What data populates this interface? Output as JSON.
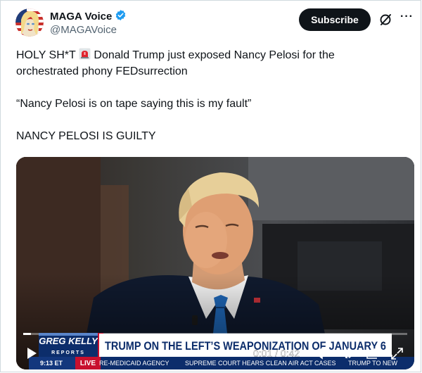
{
  "author": {
    "name": "MAGA Voice",
    "handle": "@MAGAVoice",
    "verified": true
  },
  "actions": {
    "subscribe_label": "Subscribe",
    "more_label": "···"
  },
  "tweet": {
    "line1_pre": "HOLY SH*T",
    "line1_post": "Donald Trump just exposed Nancy Pelosi for the",
    "line2": "orchestrated phony FEDsurrection",
    "quote": "“Nancy Pelosi is on tape saying this is my fault”",
    "closing": "NANCY PELOSI IS GUILTY"
  },
  "video": {
    "chyron_brand_top": "GREG KELLY",
    "chyron_brand_bottom": "REPORTS",
    "chyron_headline": "TRUMP ON THE LEFT’S WEAPONIZATION OF JANUARY 6",
    "ticker_time": "9:13 ET",
    "ticker_live": "LIVE",
    "ticker_item1": "RE-MEDICAID AGENCY",
    "ticker_item2": "SUPREME COURT HEARS CLEAN AIR ACT CASES",
    "ticker_item3": "TRUMP TO NEW",
    "time_display": "0:01 / 0:42",
    "progress_fraction": 0.02
  },
  "colors": {
    "accent_verified": "#1d9bf0",
    "text_primary": "#0f1419",
    "text_secondary": "#536471",
    "chyron_navy": "#0c2d6b",
    "chyron_red": "#c8102e"
  }
}
